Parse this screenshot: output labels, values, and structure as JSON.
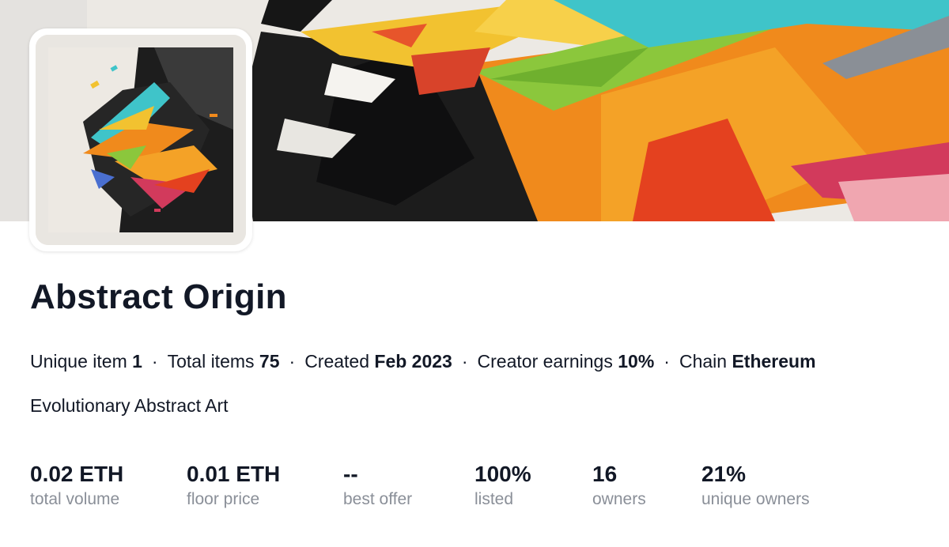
{
  "collection": {
    "name": "Abstract Origin",
    "description": "Evolutionary Abstract Art"
  },
  "meta": [
    {
      "label": "Unique item",
      "value": "1"
    },
    {
      "label": "Total items",
      "value": "75"
    },
    {
      "label": "Created",
      "value": "Feb 2023"
    },
    {
      "label": "Creator earnings",
      "value": "10%"
    },
    {
      "label": "Chain",
      "value": "Ethereum"
    }
  ],
  "meta_separator": "·",
  "stats": [
    {
      "value": "0.02 ETH",
      "label": "total volume"
    },
    {
      "value": "0.01 ETH",
      "label": "floor price"
    },
    {
      "value": "--",
      "label": "best offer"
    },
    {
      "value": "100%",
      "label": "listed"
    },
    {
      "value": "16",
      "label": "owners"
    },
    {
      "value": "21%",
      "label": "unique owners"
    }
  ],
  "colors": {
    "text": "#121826",
    "muted": "#8a8f98",
    "banner_bg": "#ece9e4"
  }
}
